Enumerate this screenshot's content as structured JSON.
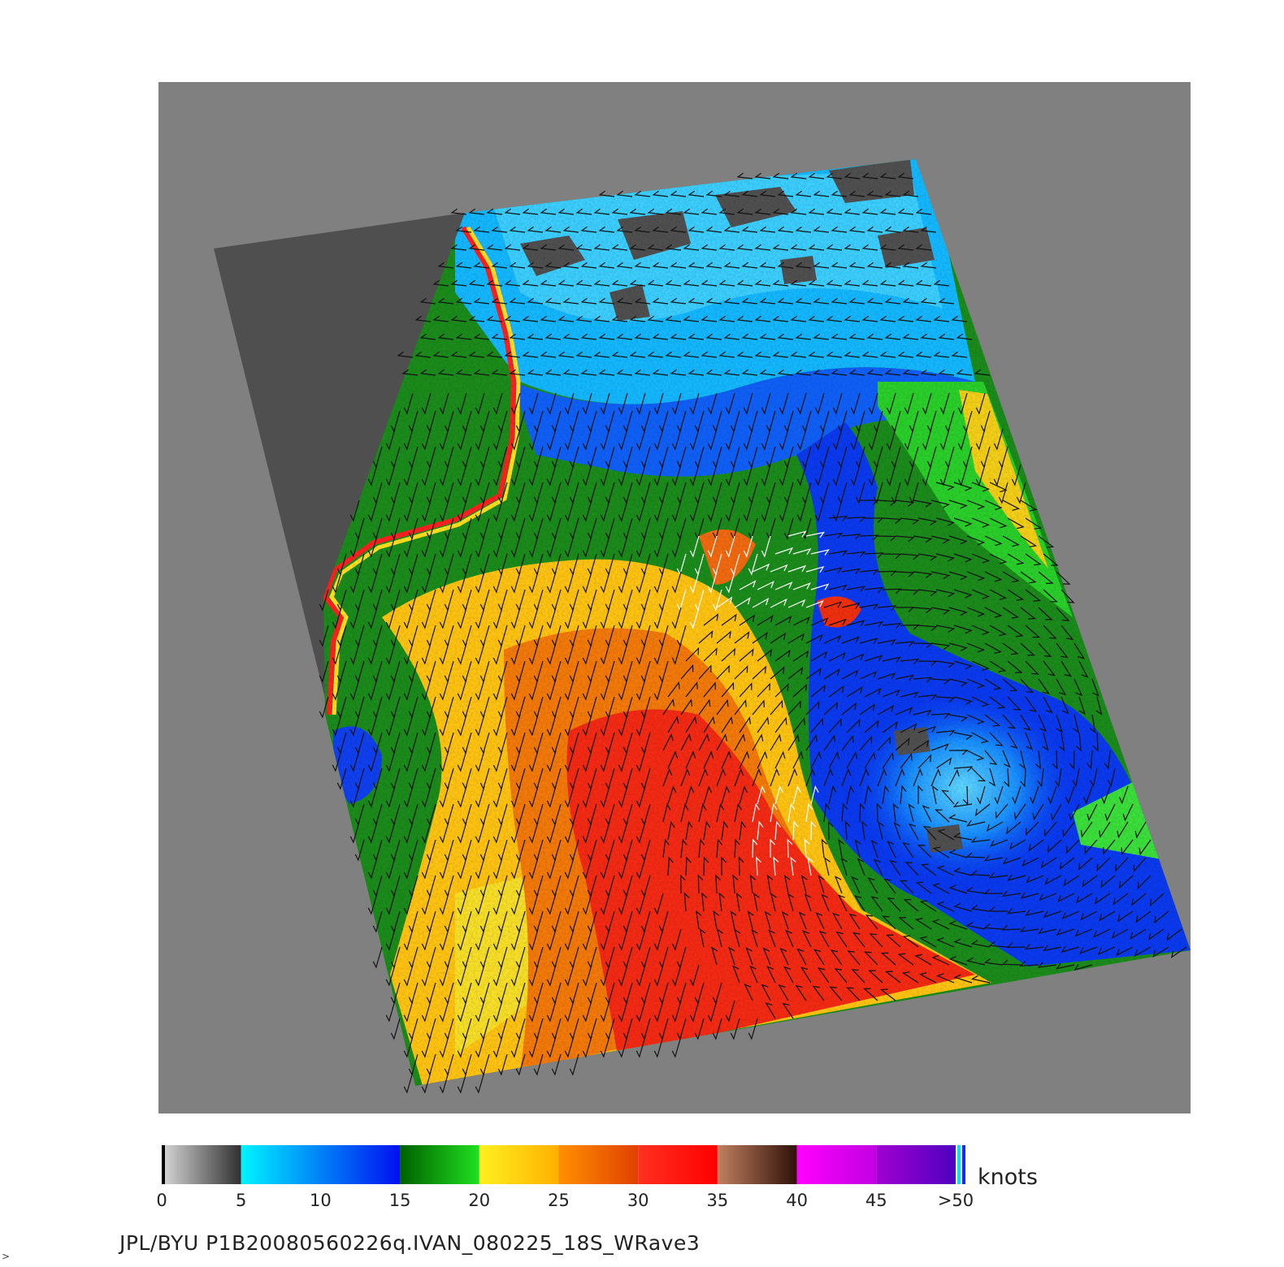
{
  "colorbar": {
    "units": "knots",
    "ticks": [
      "0",
      "5",
      "10",
      "15",
      "20",
      "25",
      "30",
      "35",
      "40",
      "45",
      ">50"
    ],
    "segments": [
      {
        "range": [
          0,
          5
        ],
        "from": "#d8d8d8",
        "to": "#303030"
      },
      {
        "range": [
          5,
          15
        ],
        "from": "#00f4ff",
        "to": "#0010f0"
      },
      {
        "range": [
          15,
          20
        ],
        "from": "#006000",
        "to": "#20e020"
      },
      {
        "range": [
          20,
          25
        ],
        "from": "#fff020",
        "to": "#ffb000"
      },
      {
        "range": [
          25,
          30
        ],
        "from": "#ff9000",
        "to": "#e04000"
      },
      {
        "range": [
          30,
          35
        ],
        "from": "#ff3020",
        "to": "#ff0000"
      },
      {
        "range": [
          35,
          40
        ],
        "from": "#c08060",
        "to": "#301008"
      },
      {
        "range": [
          40,
          45
        ],
        "from": "#ff00ff",
        "to": "#c000e0"
      },
      {
        "range": [
          45,
          50
        ],
        "from": "#a000d0",
        "to": "#5000c0"
      }
    ]
  },
  "caption": "JPL/BYU  P1B20080560226q.IVAN_080225_18S_WRave3",
  "corner_mark": ">",
  "colors": {
    "background_gray": "#808080",
    "land": "#4f4f4f",
    "barb": "#111111",
    "barb_highlight": "#ffffff"
  }
}
